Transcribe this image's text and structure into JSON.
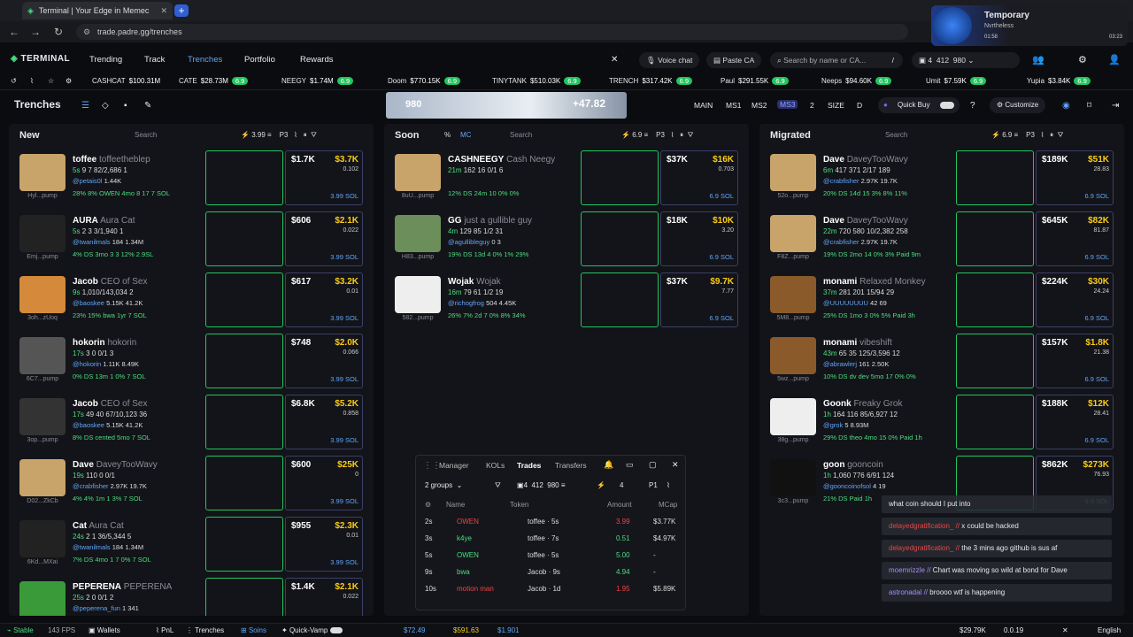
{
  "browser": {
    "tab_title": "Terminal | Your Edge in Memec",
    "url": "trade.padre.gg/trenches"
  },
  "media": {
    "title": "Temporary",
    "artist": "Nvrtheless",
    "current": "01:58",
    "duration": "03:23"
  },
  "nav": {
    "brand": "TERMINAL",
    "items": [
      "Trending",
      "Track",
      "Trenches",
      "Portfolio",
      "Rewards"
    ],
    "active": "Trenches",
    "voice_chat": "Voice chat",
    "paste_ca": "Paste CA",
    "search_placeholder": "Search by name or CA...",
    "search_key": "/",
    "wallet_count": "4",
    "wallet_a": "412",
    "wallet_b": "980"
  },
  "ticker": [
    {
      "name": "CASHCAT",
      "mc": "$100.31M"
    },
    {
      "name": "CATE",
      "mc": "$28.73M",
      "chg": "6.9"
    },
    {
      "name": "NEEGY",
      "mc": "$1.74M",
      "chg": "6.9"
    },
    {
      "name": "Doom",
      "mc": "$770.15K",
      "chg": "6.9"
    },
    {
      "name": "TINYTANK",
      "mc": "$510.03K",
      "chg": "6.9"
    },
    {
      "name": "TRENCH",
      "mc": "$317.42K",
      "chg": "6.9"
    },
    {
      "name": "Paul",
      "mc": "$291.55K",
      "chg": "6.9"
    },
    {
      "name": "Neeps",
      "mc": "$94.60K",
      "chg": "6.9"
    },
    {
      "name": "Umit",
      "mc": "$7.59K",
      "chg": "6.9"
    },
    {
      "name": "Yupia",
      "mc": "$3.84K",
      "chg": "6.9"
    }
  ],
  "trenches": {
    "title": "Trenches",
    "banner_left": "980",
    "banner_right": "+47.82",
    "presets": [
      "MAIN",
      "MS1",
      "MS2",
      "MS3",
      "2",
      "SIZE",
      "D"
    ],
    "quick_buy": "Quick Buy",
    "customize": "Customize"
  },
  "columns": {
    "new": {
      "title": "New",
      "search": "Search",
      "amt": "3.99",
      "preset": "P3"
    },
    "soon": {
      "title": "Soon",
      "pct": "%",
      "mc": "MC",
      "search": "Search",
      "amt": "6.9",
      "preset": "P3"
    },
    "migrated": {
      "title": "Migrated",
      "search": "Search",
      "amt": "6.9",
      "preset": "P3"
    }
  },
  "new_tokens": [
    {
      "sym": "toffee",
      "name": "toffeetheblep",
      "age": "5s",
      "stats": "9 7 82/2,686 1",
      "handle": "@petais0l",
      "followers": "1.44K",
      "pcts": "28% 8% OWEN 4mo 8 17 7 SOL",
      "v": "$1.7K",
      "mc": "$3.7K",
      "f": "0.102",
      "sol": "3.99 SOL",
      "img": "Hyl...pump"
    },
    {
      "sym": "AURA",
      "name": "Aura Cat",
      "age": "5s",
      "stats": "2 3 3/1,940 1",
      "handle": "@twanilmals",
      "followers": "184 1.34M",
      "pcts": "4% DS 3mo 3 3 12% 2.9SL",
      "v": "$606",
      "mc": "$2.1K",
      "f": "0.022",
      "sol": "3.99 SOL",
      "img": "Emj...pump"
    },
    {
      "sym": "Jacob",
      "name": "CEO of Sex",
      "age": "9s",
      "stats": "1,010/143,034 2",
      "handle": "@baoskee",
      "followers": "5.15K 41.2K",
      "pcts": "23% 15% bwa 1yr 7 SOL",
      "v": "$617",
      "mc": "$3.2K",
      "f": "0.01",
      "sol": "3.99 SOL",
      "img": "3oh...zUoq"
    },
    {
      "sym": "hokorin",
      "name": "hokorin",
      "age": "17s",
      "stats": "3 0 0/1 3",
      "handle": "@hokorin",
      "followers": "1.11K 8.49K",
      "pcts": "0% DS 13m 1 0% 7 SOL",
      "v": "$748",
      "mc": "$2.0K",
      "f": "0.066",
      "sol": "3.99 SOL",
      "img": "6C7...pump"
    },
    {
      "sym": "Jacob",
      "name": "CEO of Sex",
      "age": "17s",
      "stats": "49 40 67/10,123 36",
      "handle": "@baoskee",
      "followers": "5.15K 41.2K",
      "pcts": "8% DS cented 5mo 7 SOL",
      "v": "$6.8K",
      "mc": "$5.2K",
      "f": "0.858",
      "sol": "3.99 SOL",
      "img": "3op...pump"
    },
    {
      "sym": "Dave",
      "name": "DaveyTooWavy",
      "age": "19s",
      "stats": "110 0 0/1",
      "handle": "@crabfisher",
      "followers": "2.97K 19.7K",
      "pcts": "4% 4% 1m 1 3% 7 SOL",
      "v": "$600",
      "mc": "$25K",
      "f": "0",
      "sol": "3.99 SOL",
      "img": "D02...ZkCb"
    },
    {
      "sym": "Cat",
      "name": "Aura Cat",
      "age": "24s",
      "stats": "2 1 36/5,344 5",
      "handle": "@twanilmals",
      "followers": "184 1.34M",
      "pcts": "7% DS 4mo 1 7 0% 7 SOL",
      "v": "$955",
      "mc": "$2.3K",
      "f": "0.01",
      "sol": "3.99 SOL",
      "img": "6Kd...MXai"
    },
    {
      "sym": "PEPERENA",
      "name": "PEPERENA",
      "age": "25s",
      "stats": "2 0 0/1 2",
      "handle": "@peperena_fun",
      "followers": "1 341",
      "pcts": "",
      "v": "$1.4K",
      "mc": "$2.1K",
      "f": "0.022",
      "sol": "3.99 SOL",
      "img": ""
    }
  ],
  "soon_tokens": [
    {
      "sym": "CASHNEEGY",
      "name": "Cash Neegy",
      "age": "21m",
      "stats": "162 16 0/1 6",
      "handle": "",
      "followers": "",
      "pcts": "12% DS 24m 10 0% 0%",
      "v": "$37K",
      "mc": "$16K",
      "f": "0.703",
      "sol": "6.9 SOL",
      "img": "8uU...pump"
    },
    {
      "sym": "GG",
      "name": "just a gullible guy",
      "age": "4m",
      "stats": "129 85 1/2 31",
      "handle": "@agullibleguy",
      "followers": "0 3",
      "pcts": "19% DS 13d 4 0% 1% 29%",
      "v": "$18K",
      "mc": "$10K",
      "f": "3.20",
      "sol": "6.9 SOL",
      "img": "H83...pump"
    },
    {
      "sym": "Wojak",
      "name": "Wojak",
      "age": "16m",
      "stats": "79 61 1/2 19",
      "handle": "@richogfrog",
      "followers": "504 4.45K",
      "pcts": "26% 7% 2d 7 0% 8% 34%",
      "v": "$37K",
      "mc": "$9.7K",
      "f": "7.77",
      "sol": "6.9 SOL",
      "img": "582...pump"
    }
  ],
  "migrated_tokens": [
    {
      "sym": "Dave",
      "name": "DaveyTooWavy",
      "age": "6m",
      "stats": "417 371 2/17 189",
      "handle": "@crabfisher",
      "followers": "2.97K 19.7K",
      "pcts": "20% DS 14d 15 3% 8% 11%",
      "v": "$189K",
      "mc": "$51K",
      "f": "28.83",
      "sol": "6.9 SOL",
      "img": "52o...pump"
    },
    {
      "sym": "Dave",
      "name": "DaveyTooWavy",
      "age": "22m",
      "stats": "720 580 10/2,382 258",
      "handle": "@crabfisher",
      "followers": "2.97K 19.7K",
      "pcts": "19% DS 2mo 14 0% 3% Paid 9m",
      "v": "$645K",
      "mc": "$82K",
      "f": "81.87",
      "sol": "6.9 SOL",
      "img": "F8Z...pump"
    },
    {
      "sym": "monami",
      "name": "Relaxed Monkey",
      "age": "37m",
      "stats": "281 201 15/94 29",
      "handle": "@UUUUUUUU",
      "followers": "42 69",
      "pcts": "25% DS 1mo 3 0% 5% Paid 3h",
      "v": "$224K",
      "mc": "$30K",
      "f": "24.24",
      "sol": "6.9 SOL",
      "img": "5M8...pump"
    },
    {
      "sym": "monami",
      "name": "vibeshift",
      "age": "43m",
      "stats": "65 35 125/3,596 12",
      "handle": "@abrawlerj",
      "followers": "161 2.50K",
      "pcts": "10% DS dv dev 5mo 17 0% 0%",
      "v": "$157K",
      "mc": "$1.8K",
      "f": "21.38",
      "sol": "6.9 SOL",
      "img": "5wz...pump"
    },
    {
      "sym": "Goonk",
      "name": "Freaky Grok",
      "age": "1h",
      "stats": "164 116 85/6,927 12",
      "handle": "@grok",
      "followers": "5 8.93M",
      "pcts": "29% DS theo 4mo 15 0% Paid 1h",
      "v": "$188K",
      "mc": "$12K",
      "f": "28.41",
      "sol": "6.9 SOL",
      "img": "38g...pump"
    },
    {
      "sym": "goon",
      "name": "gooncoin",
      "age": "1h",
      "stats": "1,060 776 6/91 124",
      "handle": "@gooncoinofsol",
      "followers": "4 19",
      "pcts": "21% DS Paid 1h",
      "v": "$862K",
      "mc": "$273K",
      "f": "76.93",
      "sol": "6.9 SOL",
      "img": "3c3...pump"
    }
  ],
  "trades_panel": {
    "tabs": [
      "Manager",
      "KOLs",
      "Trades",
      "Transfers"
    ],
    "active_tab": "Trades",
    "groups": "2 groups",
    "w1": "4",
    "w2": "412",
    "w3": "980",
    "w4": "4",
    "preset": "P1",
    "headers": [
      "Name",
      "Token",
      "Amount",
      "MCap"
    ],
    "rows": [
      {
        "t": "2s",
        "name": "OWEN",
        "token": "toffee · 5s",
        "amount": "3.99",
        "mcap": "$3.77K",
        "sell": true
      },
      {
        "t": "3s",
        "name": "k4ye",
        "token": "toffee · 7s",
        "amount": "0.51",
        "mcap": "$4.97K",
        "sell": false
      },
      {
        "t": "5s",
        "name": "OWEN",
        "token": "toffee · 5s",
        "amount": "5.00",
        "mcap": "-",
        "sell": false
      },
      {
        "t": "9s",
        "name": "bwa",
        "token": "Jacob · 9s",
        "amount": "4.94",
        "mcap": "-",
        "sell": false
      },
      {
        "t": "10s",
        "name": "motion man",
        "token": "Jacob · 1d",
        "amount": "1.95",
        "mcap": "$5.89K",
        "sell": true
      }
    ]
  },
  "chat": [
    {
      "user": "",
      "msg": "what coin should I put into"
    },
    {
      "user": "delayedgratification_ //",
      "msg": "x could be hacked"
    },
    {
      "user": "delayedgratification_ //",
      "msg": "the 3 mins ago github is sus af"
    },
    {
      "user": "moemrizzle //",
      "msg": "Chart was moving so wild at bond for Dave"
    },
    {
      "user": "astronadal //",
      "msg": "broooo wtf is happening"
    }
  ],
  "status": {
    "state": "Stable",
    "fps": "143 FPS",
    "wallets": "Wallets",
    "pnl": "PnL",
    "trenches": "Trenches",
    "soins": "Soins",
    "quickvamp": "Quick-Vamp",
    "p1": "$72.49",
    "p2": "$591.63",
    "p3": "$1.901",
    "right1": "$29.79K",
    "right2": "0.0.19",
    "lang": "English"
  },
  "colors": {
    "accent": "#60a5fa",
    "green": "#22c55e",
    "red": "#ef4444",
    "gold": "#facc15",
    "purple": "#8b5cf6"
  }
}
